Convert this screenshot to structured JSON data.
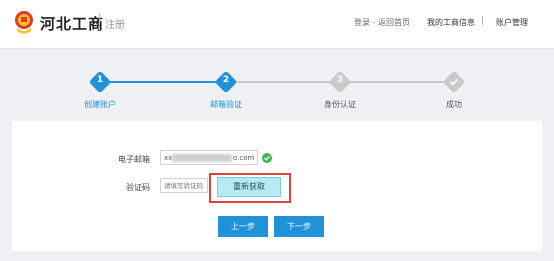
{
  "header": {
    "brand": "河北工商",
    "subtitle": "注册",
    "nav": {
      "login": "登录 - 返回首页",
      "my_info": "我的工商信息",
      "separator": "|",
      "account": "账户管理"
    }
  },
  "steps": [
    {
      "num": "1",
      "label": "创建账户",
      "state": "done"
    },
    {
      "num": "2",
      "label": "邮箱验证",
      "state": "active"
    },
    {
      "num": "3",
      "label": "身份认证",
      "state": "pending"
    },
    {
      "num": "",
      "label": "成功",
      "state": "pending"
    }
  ],
  "colors": {
    "active": "#1f92d8",
    "pending": "#c9c9c9",
    "highlight": "#e0413b",
    "ok": "#3cb84a"
  },
  "form": {
    "email_label": "电子邮箱",
    "email_prefix": "xx",
    "email_suffix": "o.com",
    "code_label": "验证码",
    "code_placeholder": "请填写验证码",
    "resend_label": "重新获取",
    "prev_label": "上一步",
    "next_label": "下一步"
  }
}
